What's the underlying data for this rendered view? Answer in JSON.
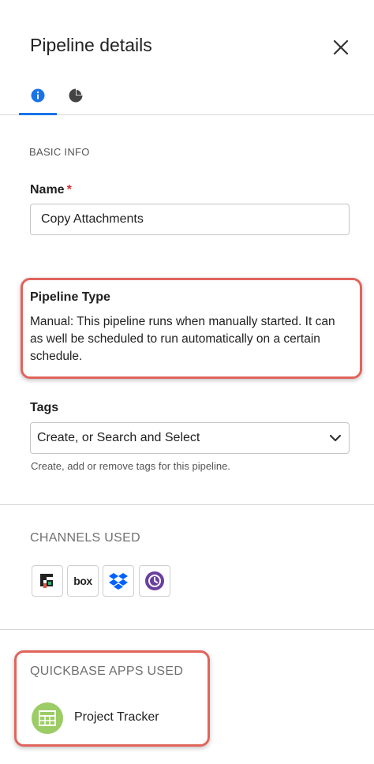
{
  "panel": {
    "title": "Pipeline details",
    "tabs": [
      {
        "id": "info",
        "icon": "info-icon",
        "active": true
      },
      {
        "id": "stats",
        "icon": "pie-chart-icon",
        "active": false
      }
    ]
  },
  "basic_info": {
    "section_label": "BASIC INFO",
    "name_label": "Name",
    "name_required_mark": "*",
    "name_value": "Copy Attachments"
  },
  "pipeline_type": {
    "label": "Pipeline Type",
    "description": "Manual: This pipeline runs when manually started. It can as well be scheduled to run automatically on a certain schedule."
  },
  "tags": {
    "label": "Tags",
    "selected": "Create, or Search and Select",
    "helper": "Create, add or remove tags for this pipeline."
  },
  "channels": {
    "label": "CHANNELS USED",
    "items": [
      {
        "name": "quickbase",
        "icon": "quickbase-logo-icon"
      },
      {
        "name": "box",
        "icon": "box-logo-icon",
        "text": "box"
      },
      {
        "name": "dropbox",
        "icon": "dropbox-logo-icon"
      },
      {
        "name": "schedule",
        "icon": "clock-icon"
      }
    ]
  },
  "apps": {
    "label": "QUICKBASE APPS USED",
    "items": [
      {
        "name": "Project Tracker",
        "icon": "table-grid-icon",
        "color": "#9ccc65"
      }
    ]
  },
  "colors": {
    "accent": "#1a73e8",
    "required": "#d32f2f",
    "callout": "#e1645c",
    "dropbox": "#0061fe",
    "schedule": "#6a3fa0"
  }
}
